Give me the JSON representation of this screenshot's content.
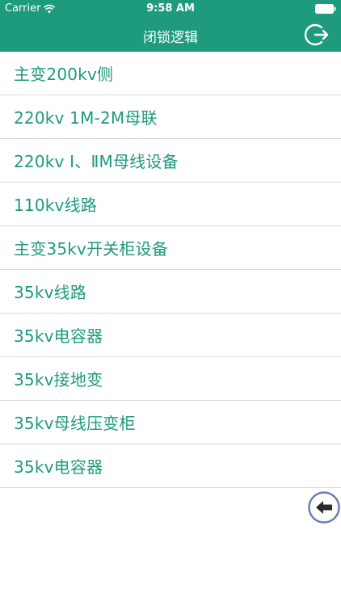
{
  "status_bar": {
    "carrier": "Carrier",
    "time": "9:58 AM"
  },
  "nav": {
    "title": "闭锁逻辑",
    "logout_icon": "logout-icon"
  },
  "list": {
    "items": [
      {
        "label": "主变200kv侧"
      },
      {
        "label": "220kv 1M-2M母联"
      },
      {
        "label": "220kv Ⅰ、ⅡM母线设备"
      },
      {
        "label": "110kv线路"
      },
      {
        "label": "主变35kv开关柜设备"
      },
      {
        "label": "35kv线路"
      },
      {
        "label": "35kv电容器"
      },
      {
        "label": "35kv接地变"
      },
      {
        "label": "35kv母线压变柜"
      },
      {
        "label": "35kv电容器"
      }
    ]
  },
  "floating": {
    "back_icon": "back-arrow-icon"
  },
  "colors": {
    "accent": "#1e9a7d",
    "divider": "#d9d9d9",
    "back_button_ring": "#6b7fb8"
  }
}
